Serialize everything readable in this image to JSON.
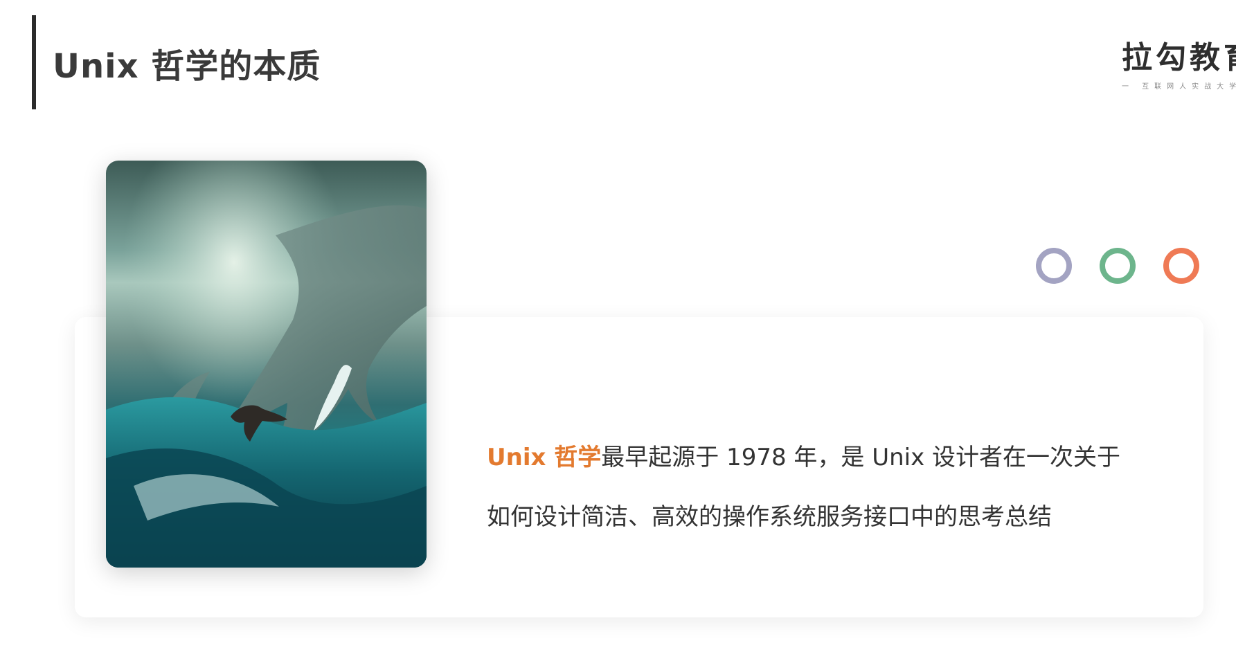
{
  "header": {
    "title": "Unix 哲学的本质"
  },
  "logo": {
    "main": "拉勾教育",
    "sub": "一  互联网人实战大学"
  },
  "circles": {
    "colors": [
      "#a3a3c2",
      "#6db58c",
      "#ef7a55"
    ]
  },
  "content": {
    "highlight": "Unix 哲学",
    "line1_rest": "最早起源于 1978 年，是 Unix 设计者在一次关于",
    "line2": "如何设计简洁、高效的操作系统服务接口中的思考总结"
  }
}
